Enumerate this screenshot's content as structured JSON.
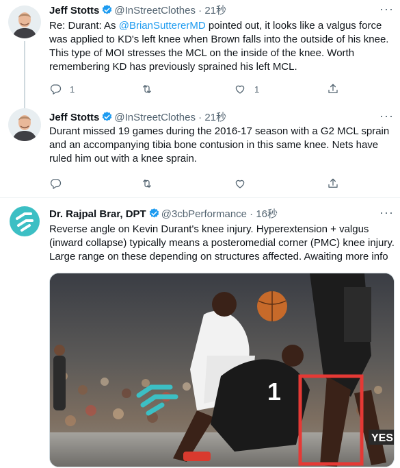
{
  "tweets": [
    {
      "author_name": "Jeff Stotts",
      "handle": "@InStreetClothes",
      "separator": "·",
      "time": "21秒",
      "text_prefix": "Re: Durant: As ",
      "mention": "@BrianSuttererMD",
      "text_suffix": " pointed out, it looks like a valgus force was applied to KD's left knee when Brown falls into the outside of his knee. This type of MOI stresses the MCL on the inside of the knee. Worth remembering KD has previously sprained his left MCL.",
      "reply_count": "1",
      "retweet_count": "",
      "like_count": "1"
    },
    {
      "author_name": "Jeff Stotts",
      "handle": "@InStreetClothes",
      "separator": "·",
      "time": "21秒",
      "text": "Durant missed 19 games during the 2016-17 season with a G2 MCL sprain and an accompanying tibia bone contusion in this same knee. Nets have ruled him out with a knee sprain.",
      "reply_count": "",
      "retweet_count": "",
      "like_count": ""
    },
    {
      "author_name": "Dr. Rajpal Brar, DPT",
      "handle": "@3cbPerformance",
      "separator": "·",
      "time": "16秒",
      "text": "Reverse angle on Kevin Durant's knee injury. Hyperextension + valgus (inward collapse) typically means a posteromedial corner (PMC) knee injury. Large range on these depending on structures affected. Awaiting more info",
      "media": {
        "jersey_number": "1",
        "broadcast_bug": "YES"
      }
    }
  ],
  "icons": {
    "more": "more-icon",
    "reply": "reply-icon",
    "retweet": "retweet-icon",
    "like": "like-icon",
    "share": "share-icon",
    "verified": "verified-badge-icon"
  },
  "colors": {
    "accent": "#1d9bf0",
    "secondary_text": "#536471",
    "highlight_box": "#e53935",
    "logo_teal": "#3cbfc4"
  }
}
